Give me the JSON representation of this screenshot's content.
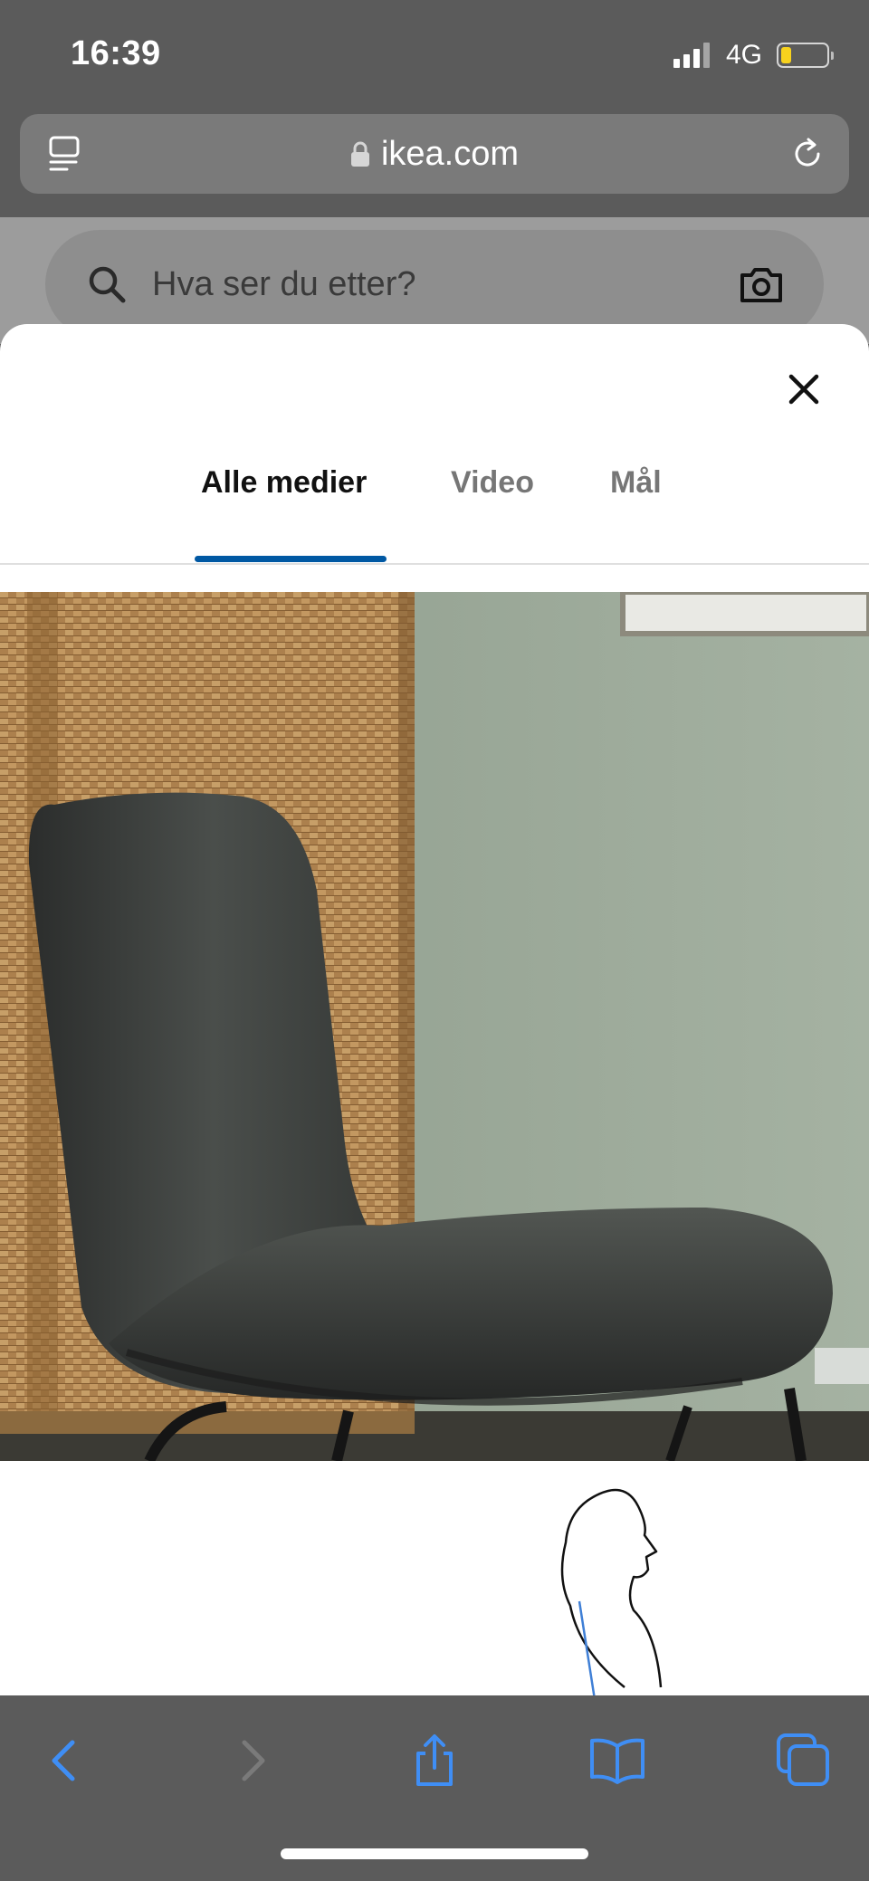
{
  "status_bar": {
    "time": "16:39",
    "network": "4G",
    "battery_color": "#f7d21d"
  },
  "browser": {
    "url": "ikea.com",
    "tabs_icon": "tabs-icon",
    "lock_icon": "lock-icon",
    "reload_icon": "reload-icon"
  },
  "page": {
    "search": {
      "placeholder": "Hva ser du etter?",
      "search_icon": "search-icon",
      "camera_icon": "camera-icon"
    }
  },
  "media_modal": {
    "close_icon": "close-icon",
    "tabs": [
      {
        "label": "Alle medier",
        "active": true
      },
      {
        "label": "Video",
        "active": false
      },
      {
        "label": "Mål",
        "active": false
      }
    ],
    "accent_color": "#0058a3",
    "images": [
      "chair-photo",
      "posture-diagram"
    ]
  },
  "toolbar": {
    "back_icon": "back-icon",
    "forward_icon": "forward-icon",
    "share_icon": "share-icon",
    "bookmarks_icon": "bookmarks-icon",
    "tabs_icon": "tabs-overview-icon",
    "accent_color": "#3f8ef5"
  }
}
